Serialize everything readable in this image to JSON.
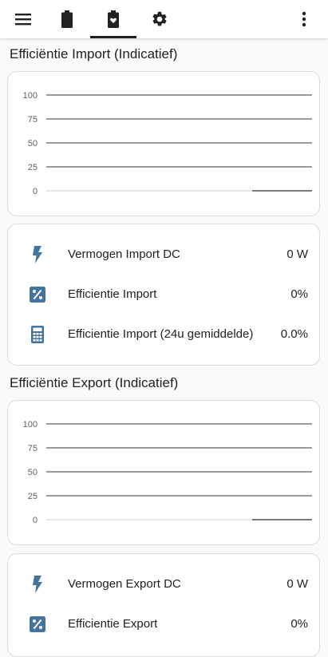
{
  "topbar": {
    "tabs": [
      {
        "icon": "menu-icon"
      },
      {
        "icon": "battery-icon"
      },
      {
        "icon": "battery-heart-icon",
        "active": true
      },
      {
        "icon": "gear-icon"
      },
      {
        "icon": "more-vert-icon"
      }
    ]
  },
  "sections": [
    {
      "title": "Efficiëntie Import (Indicatief)",
      "chart_data": {
        "type": "line",
        "yticks": [
          "100",
          "75",
          "50",
          "25",
          "0"
        ],
        "ylim": [
          0,
          100
        ],
        "series": [
          {
            "values": [
              0,
              0
            ]
          }
        ]
      },
      "rows": [
        {
          "icon": "flash-icon",
          "label": "Vermogen Import DC",
          "value": "0 W"
        },
        {
          "icon": "percent-icon",
          "label": "Efficientie Import",
          "value": "0%"
        },
        {
          "icon": "calculator-icon",
          "label": "Efficientie Import (24u gemiddelde)",
          "value": "0.0%"
        }
      ]
    },
    {
      "title": "Efficiëntie Export (Indicatief)",
      "chart_data": {
        "type": "line",
        "yticks": [
          "100",
          "75",
          "50",
          "25",
          "0"
        ],
        "ylim": [
          0,
          100
        ],
        "series": [
          {
            "values": [
              0,
              0
            ]
          }
        ]
      },
      "rows": [
        {
          "icon": "flash-icon",
          "label": "Vermogen Export DC",
          "value": "0 W"
        },
        {
          "icon": "percent-icon",
          "label": "Efficientie Export",
          "value": "0%"
        }
      ]
    }
  ],
  "colors": {
    "icon_blue": "#44739e",
    "text": "#212121",
    "tick": "#616161"
  }
}
